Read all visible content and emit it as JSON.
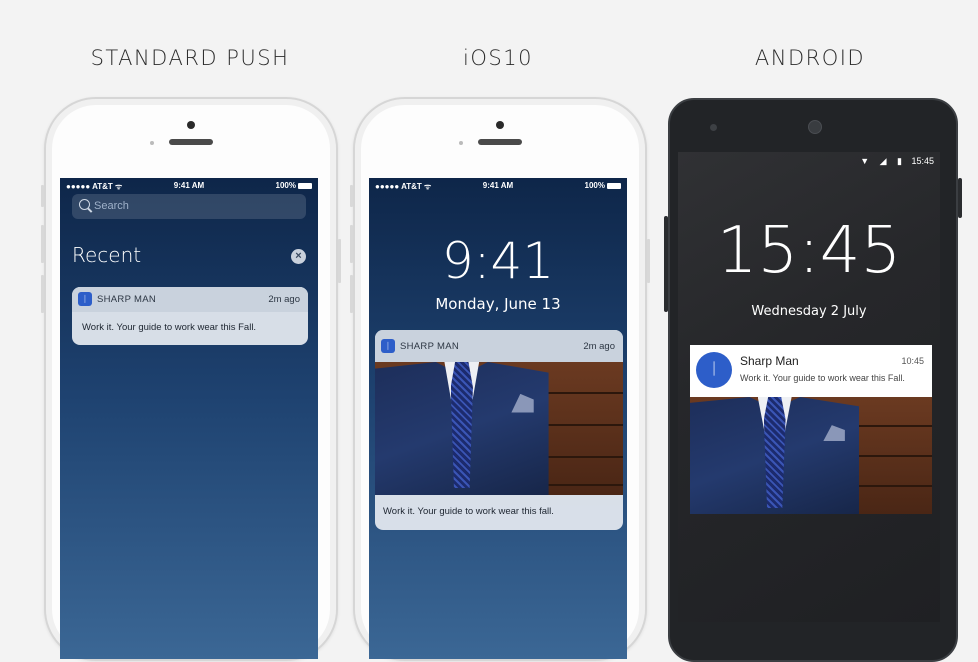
{
  "headings": {
    "standard": "STANDARD PUSH",
    "ios10": "iOS10",
    "android": "ANDROID"
  },
  "standard_push": {
    "status": {
      "carrier": "●●●●● AT&T ᯤ",
      "time": "9:41 AM",
      "battery": "100%"
    },
    "search_placeholder": "Search",
    "section_title": "Recent",
    "clear_icon": "x-circle-icon",
    "notification": {
      "app_name": "SHARP MAN",
      "time_ago": "2m ago",
      "message": "Work it. Your guide to work wear this Fall."
    }
  },
  "ios10": {
    "status": {
      "carrier": "●●●●● AT&T ᯤ",
      "time": "9:41 AM",
      "battery": "100%"
    },
    "lock_time": "9:41",
    "lock_date": "Monday, June 13",
    "notification": {
      "app_name": "SHARP MAN",
      "time_ago": "2m ago",
      "message": "Work it. Your guide to work wear this fall."
    }
  },
  "android": {
    "status": {
      "icons": "▼ ◢ ▮",
      "time": "15:45"
    },
    "lock_time": "15:45",
    "lock_date": "Wednesday 2 July",
    "notification": {
      "title": "Sharp Man",
      "time": "10:45",
      "message": "Work it. Your guide to work wear this Fall."
    }
  },
  "colors": {
    "app_icon": "#2d5ec9",
    "ios_bg_top": "#0e2649",
    "android_body": "#222427"
  }
}
